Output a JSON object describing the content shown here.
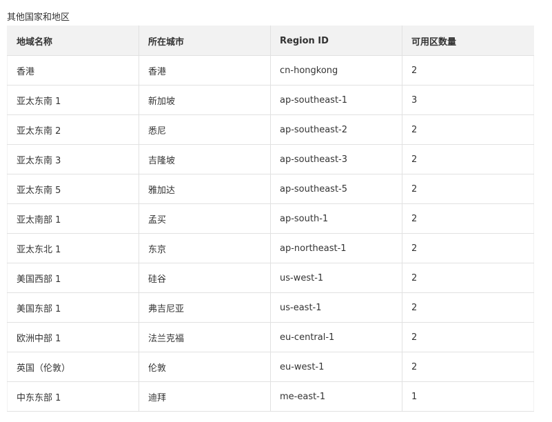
{
  "section": {
    "title": "其他国家和地区"
  },
  "table": {
    "headers": [
      "地域名称",
      "所在城市",
      "Region ID",
      "可用区数量"
    ],
    "rows": [
      [
        "香港",
        "香港",
        "cn-hongkong",
        "2"
      ],
      [
        "亚太东南 1",
        "新加坡",
        "ap-southeast-1",
        "3"
      ],
      [
        "亚太东南 2",
        "悉尼",
        "ap-southeast-2",
        "2"
      ],
      [
        "亚太东南 3",
        "吉隆坡",
        "ap-southeast-3",
        "2"
      ],
      [
        "亚太东南 5",
        "雅加达",
        "ap-southeast-5",
        "2"
      ],
      [
        "亚太南部 1",
        "孟买",
        "ap-south-1",
        "2"
      ],
      [
        "亚太东北 1",
        "东京",
        "ap-northeast-1",
        "2"
      ],
      [
        "美国西部 1",
        "硅谷",
        "us-west-1",
        "2"
      ],
      [
        "美国东部 1",
        "弗吉尼亚",
        "us-east-1",
        "2"
      ],
      [
        "欧洲中部 1",
        "法兰克福",
        "eu-central-1",
        "2"
      ],
      [
        "英国（伦敦）",
        "伦敦",
        "eu-west-1",
        "2"
      ],
      [
        "中东东部 1",
        "迪拜",
        "me-east-1",
        "1"
      ]
    ]
  },
  "colors": {
    "header_bg": "#f2f2f2",
    "border": "#e1e1e1",
    "text": "#333333"
  }
}
